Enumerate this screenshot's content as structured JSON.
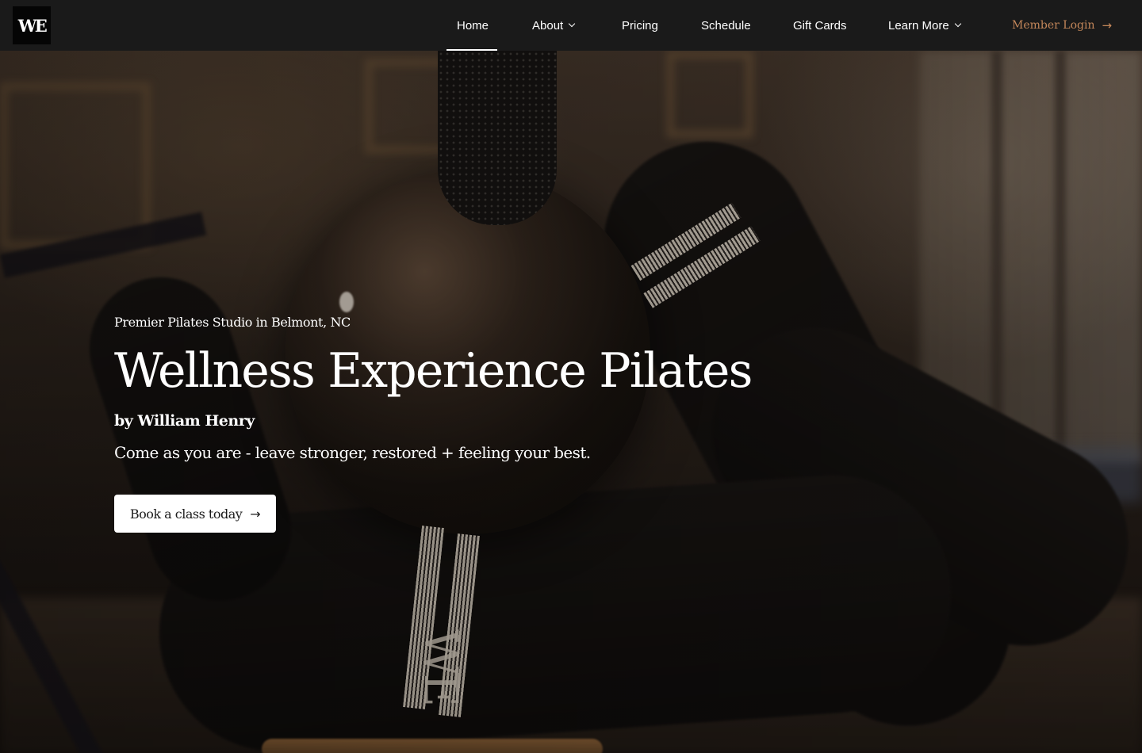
{
  "brand": {
    "logo_text": "WE"
  },
  "nav": {
    "items": [
      {
        "label": "Home",
        "active": true,
        "has_dropdown": false
      },
      {
        "label": "About",
        "active": false,
        "has_dropdown": true
      },
      {
        "label": "Pricing",
        "active": false,
        "has_dropdown": false
      },
      {
        "label": "Schedule",
        "active": false,
        "has_dropdown": false
      },
      {
        "label": "Gift Cards",
        "active": false,
        "has_dropdown": false
      },
      {
        "label": "Learn More",
        "active": false,
        "has_dropdown": true
      }
    ],
    "member_login": {
      "label": "Member Login",
      "icon": "arrow-right-icon"
    }
  },
  "hero": {
    "eyebrow": "Premier Pilates Studio in Belmont, NC",
    "title": "Wellness Experience Pilates",
    "byline": "by William Henry",
    "tagline": "Come as you are - leave stronger, restored + feeling your best.",
    "cta": {
      "label": "Book a class today",
      "icon": "arrow-right-icon"
    },
    "image_sock_text": "WE"
  },
  "colors": {
    "navbar_bg": "#1a1a1a",
    "accent": "#c4875a",
    "text": "#ffffff",
    "cta_bg": "#ffffff"
  }
}
